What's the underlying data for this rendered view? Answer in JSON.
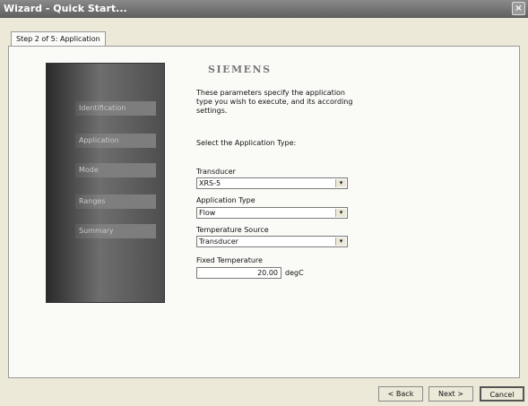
{
  "window": {
    "title": "Wizard - Quick Start...",
    "close_glyph": "×"
  },
  "tab": {
    "label": "Step 2 of 5: Application"
  },
  "steps": [
    "Identification",
    "Application",
    "Mode",
    "Ranges",
    "Summary"
  ],
  "brand": {
    "logo_text": "SIEMENS"
  },
  "description": "These parameters specify the application type you wish to execute, and its according settings.",
  "select_prompt": "Select the Application Type:",
  "fields": {
    "transducer": {
      "label": "Transducer",
      "value": "XRS-5"
    },
    "application_type": {
      "label": "Application Type",
      "value": "Flow"
    },
    "temperature_source": {
      "label": "Temperature Source",
      "value": "Transducer"
    },
    "fixed_temperature": {
      "label": "Fixed Temperature",
      "value": "20.00",
      "unit": "degC"
    }
  },
  "dropdown_glyph": "▾",
  "buttons": {
    "back": "< Back",
    "next": "Next >",
    "cancel": "Cancel"
  }
}
